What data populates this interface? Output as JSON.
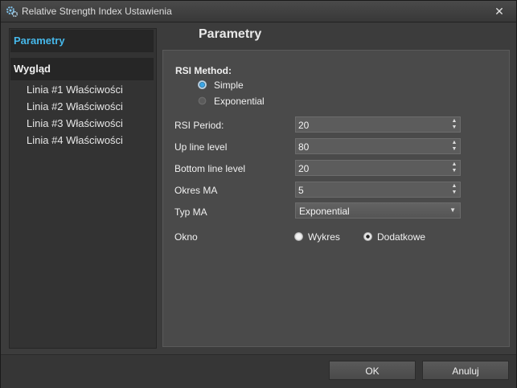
{
  "window": {
    "title": "Relative Strength Index Ustawienia",
    "close_glyph": "✕"
  },
  "sidebar": {
    "items": [
      {
        "label": "Parametry"
      },
      {
        "label": "Wygląd"
      }
    ],
    "sub_items": [
      {
        "label": "Linia #1 Właściwości"
      },
      {
        "label": "Linia #2 Właściwości"
      },
      {
        "label": "Linia #3 Właściwości"
      },
      {
        "label": "Linia #4 Właściwości"
      }
    ]
  },
  "main": {
    "title": "Parametry",
    "rsi_method": {
      "label": "RSI Method:",
      "options": [
        {
          "label": "Simple",
          "selected": true
        },
        {
          "label": "Exponential",
          "selected": false
        }
      ]
    },
    "fields": [
      {
        "label": "RSI Period:",
        "value": "20"
      },
      {
        "label": "Up line level",
        "value": "80"
      },
      {
        "label": "Bottom line level",
        "value": "20"
      },
      {
        "label": "Okres MA",
        "value": "5"
      }
    ],
    "typ_ma": {
      "label": "Typ MA",
      "value": "Exponential"
    },
    "okno": {
      "label": "Okno",
      "options": [
        {
          "label": "Wykres",
          "selected": false
        },
        {
          "label": "Dodatkowe",
          "selected": true
        }
      ]
    }
  },
  "footer": {
    "ok_label": "OK",
    "cancel_label": "Anuluj"
  },
  "colors": {
    "accent": "#46b8ea",
    "background": "#3c3c3c",
    "panel": "#4a4a4a"
  }
}
